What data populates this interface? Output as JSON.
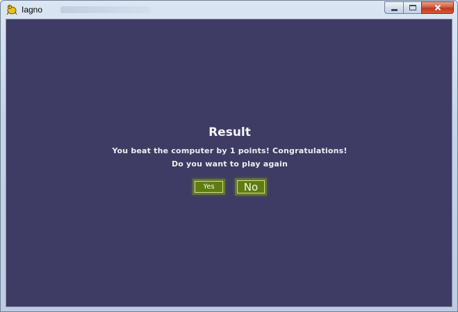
{
  "window": {
    "title": "Iagno",
    "icon": "pygame-snake-icon",
    "controls": [
      "minimize-icon",
      "maximize-icon",
      "close-icon"
    ]
  },
  "colors": {
    "background": "#3e3c64",
    "button_fill": "#5f7c11",
    "button_glow": "#7e961e",
    "text": "#f2f2f2",
    "close_button": "#c0391b"
  },
  "dialog": {
    "title": "Result",
    "message_line1": "You beat the computer by 1 points! Congratulations!",
    "message_line2": "Do you want to play again",
    "yes_label": "Yes",
    "no_label": "No"
  }
}
